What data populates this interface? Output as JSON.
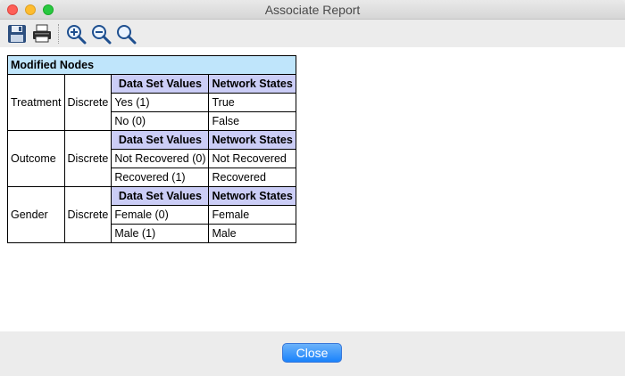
{
  "window": {
    "title": "Associate Report"
  },
  "toolbar": {
    "buttons": [
      {
        "name": "save-icon"
      },
      {
        "name": "print-icon"
      },
      {
        "name": "zoom-in-icon"
      },
      {
        "name": "zoom-out-icon"
      },
      {
        "name": "zoom-reset-icon"
      }
    ]
  },
  "report": {
    "header": "Modified Nodes",
    "col_data_set": "Data Set Values",
    "col_network": "Network States",
    "nodes": [
      {
        "name": "Treatment",
        "type": "Discrete",
        "rows": [
          [
            "Yes (1)",
            "True"
          ],
          [
            "No (0)",
            "False"
          ]
        ]
      },
      {
        "name": "Outcome",
        "type": "Discrete",
        "rows": [
          [
            "Not Recovered (0)",
            "Not Recovered"
          ],
          [
            "Recovered (1)",
            "Recovered"
          ]
        ]
      },
      {
        "name": "Gender",
        "type": "Discrete",
        "rows": [
          [
            "Female (0)",
            "Female"
          ],
          [
            "Male (1)",
            "Male"
          ]
        ]
      }
    ]
  },
  "footer": {
    "close_label": "Close"
  },
  "colors": {
    "header_bg": "#bfe5fb",
    "column_header_bg": "#cbcdf6",
    "button_blue": "#1a82fb"
  }
}
